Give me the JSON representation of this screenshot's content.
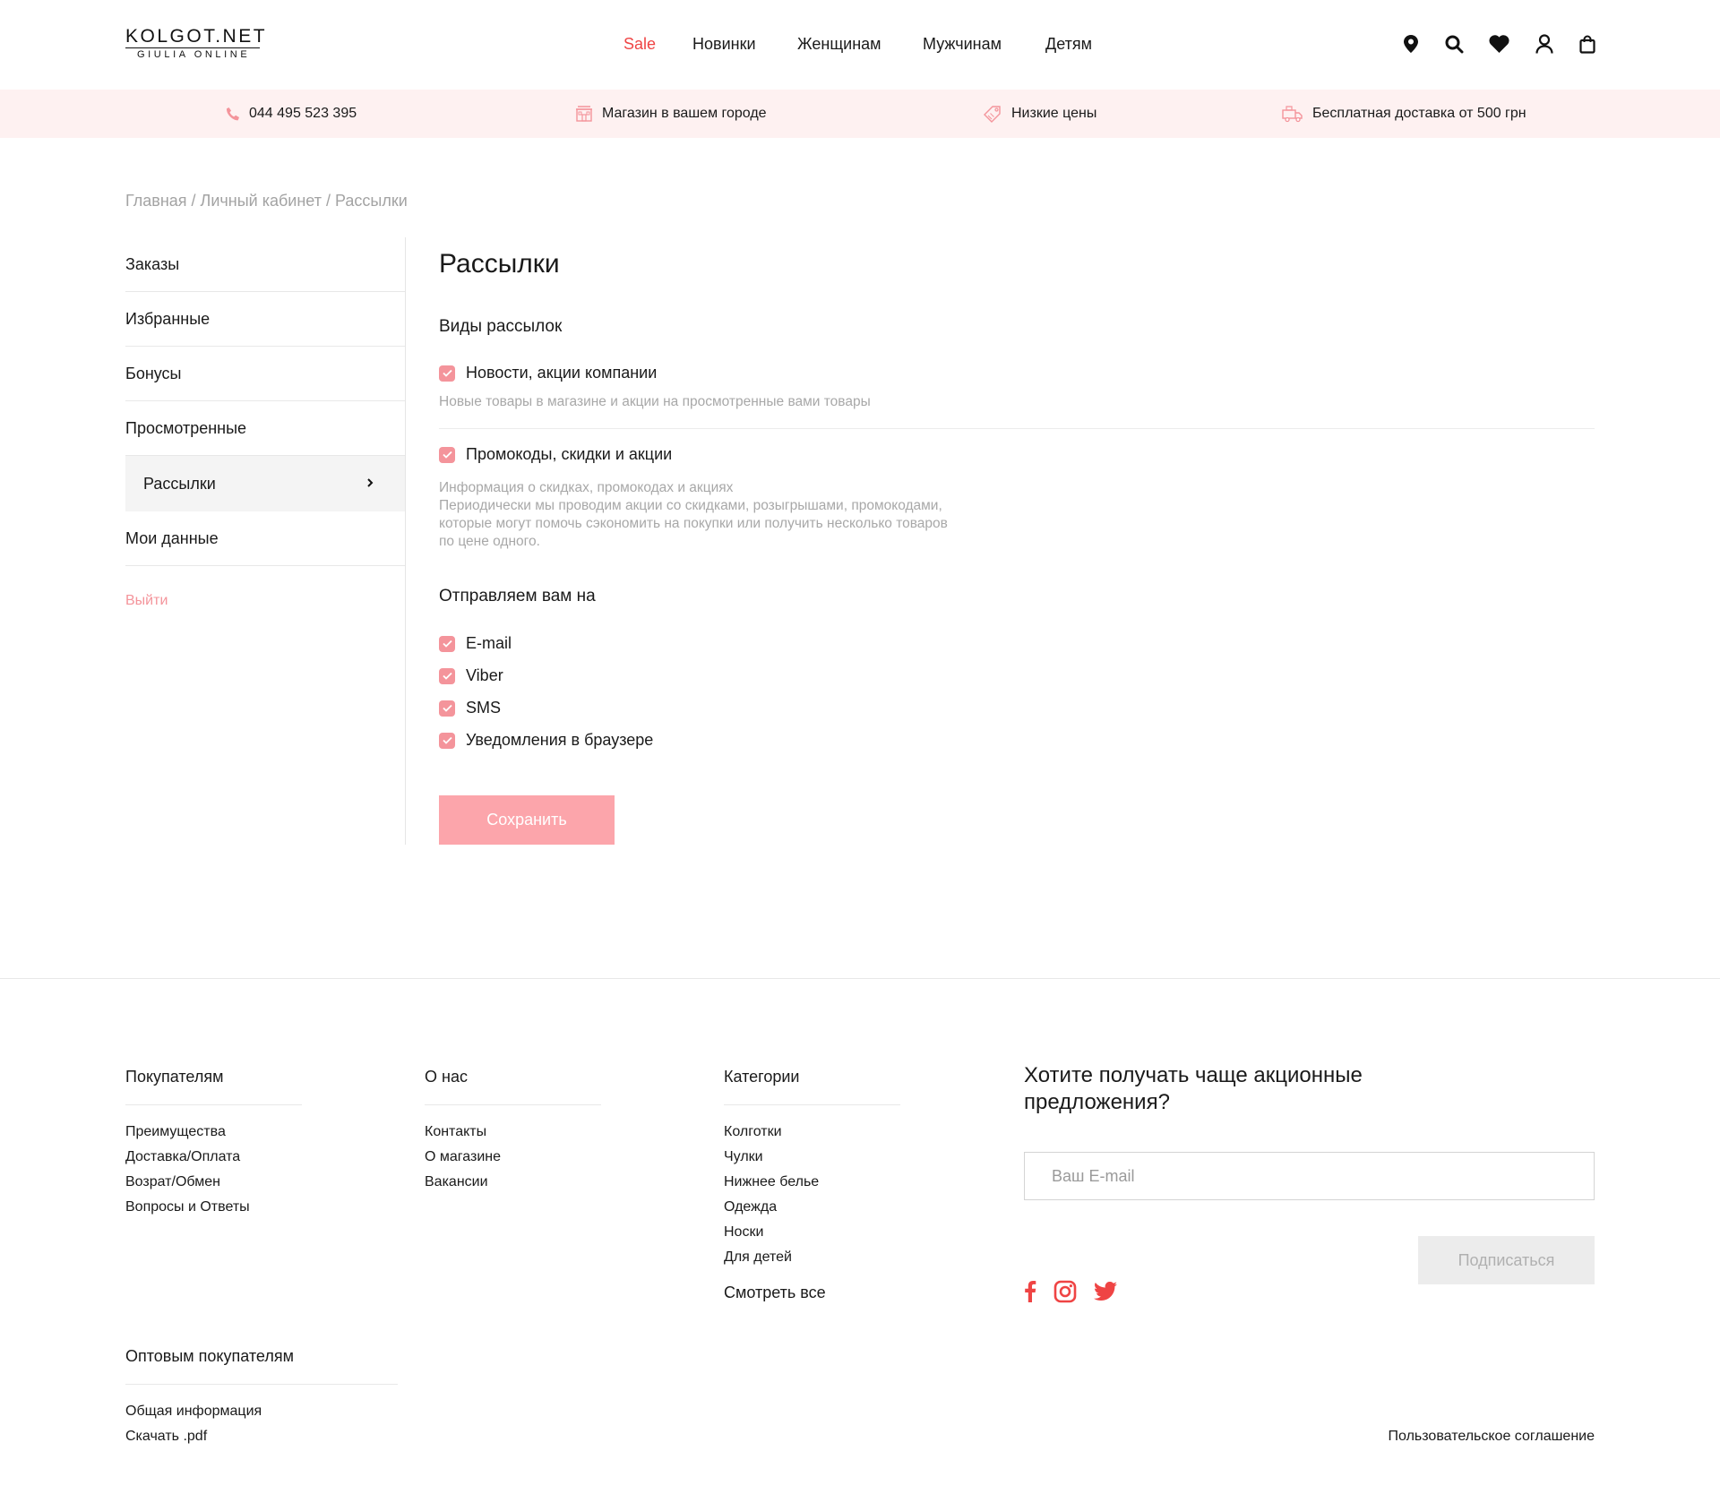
{
  "brand": {
    "name": "KOLGOT.NET",
    "tagline": "GIULIA ONLINE",
    "accent": "#ef4444",
    "pink": "#f4949b",
    "soft_pink_bg": "#fef1f1"
  },
  "nav": {
    "sale": "Sale",
    "new": "Новинки",
    "women": "Женщинам",
    "men": "Мужчинам",
    "kids": "Детям"
  },
  "header_icons": [
    "location-icon",
    "search-icon",
    "heart-icon",
    "user-icon",
    "bag-icon"
  ],
  "infobar": {
    "phone": "044 495 523 395",
    "store": "Магазин в вашем городе",
    "prices": "Низкие цены",
    "delivery": "Бесплатная доставка от 500 грн"
  },
  "breadcrumb": {
    "home": "Главная",
    "sep": " / ",
    "account": "Личный кабинет",
    "current": "Рассылки"
  },
  "sidebar": {
    "items": [
      {
        "label": "Заказы"
      },
      {
        "label": "Избранные"
      },
      {
        "label": "Бонусы"
      },
      {
        "label": "Просмотренные"
      },
      {
        "label": "Рассылки",
        "active": true
      },
      {
        "label": "Мои данные"
      }
    ],
    "logout": "Выйти"
  },
  "main": {
    "title": "Рассылки",
    "types_title": "Виды рассылок",
    "types": [
      {
        "label": "Новости, акции компании",
        "checked": true,
        "desc": "Новые товары в магазине и акции на просмотренные вами товары"
      },
      {
        "label": "Промокоды, скидки и акции",
        "checked": true,
        "desc_line1": "Информация о скидках, промокодах и акциях",
        "desc_line2": "Периодически мы проводим акции со скидками, розыгрышами, промокодами,",
        "desc_line3": "которые могут помочь сэкономить на покупки или получить несколько товаров",
        "desc_line4": "по цене одного."
      }
    ],
    "channels_title": "Отправляем вам на",
    "channels": [
      {
        "label": "E-mail",
        "checked": true
      },
      {
        "label": "Viber",
        "checked": true
      },
      {
        "label": "SMS",
        "checked": true
      },
      {
        "label": "Уведомления в браузере",
        "checked": true
      }
    ],
    "save": "Сохранить"
  },
  "footer": {
    "buyers": {
      "title": "Покупателям",
      "links": [
        "Преимущества",
        "Доставка/Оплата",
        "Возрат/Обмен",
        "Вопросы и Ответы"
      ]
    },
    "about": {
      "title": "О нас",
      "links": [
        "Контакты",
        "О магазине",
        "Вакансии"
      ]
    },
    "categories": {
      "title": "Категории",
      "links": [
        "Колготки",
        "Чулки",
        "Нижнее белье",
        "Одежда",
        "Носки",
        "Для детей"
      ],
      "see_all": "Смотреть все"
    },
    "wholesale": {
      "title": "Оптовым покупателям",
      "links": [
        "Общая информация",
        "Скачать .pdf"
      ]
    },
    "subscribe": {
      "title_line1": "Хотите получать чаще акционные",
      "title_line2": "предложения?",
      "placeholder": "Ваш E-mail",
      "button": "Подписаться"
    },
    "social": [
      "facebook-icon",
      "instagram-icon",
      "twitter-icon"
    ],
    "agreement": "Пользовательское соглашение"
  }
}
